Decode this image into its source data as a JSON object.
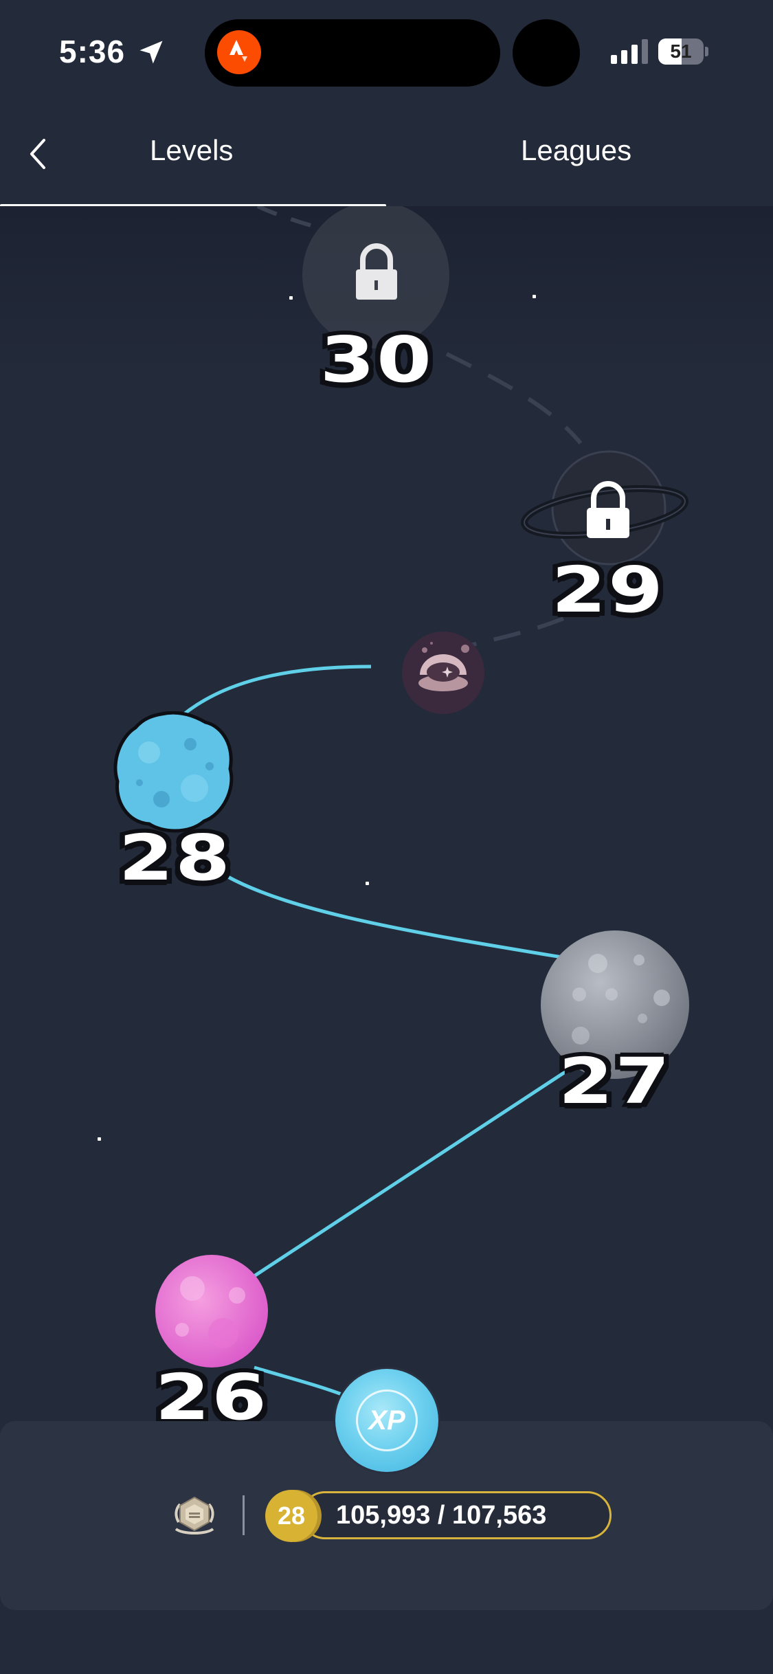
{
  "status_bar": {
    "time": "5:36",
    "battery": "51",
    "battery_level": 0.51,
    "icons": [
      "location-arrow-icon",
      "strava-icon",
      "signal-icon",
      "battery-icon"
    ]
  },
  "tabs": [
    {
      "label": "Levels",
      "selected": true
    },
    {
      "label": "Leagues",
      "selected": false
    }
  ],
  "levels": [
    {
      "number": "30",
      "state": "locked",
      "planet": "faded-locked"
    },
    {
      "number": "29",
      "state": "locked",
      "planet": "ringed-locked"
    },
    {
      "number": "28",
      "state": "current",
      "planet": "blue-rocky"
    },
    {
      "number": "27",
      "state": "completed",
      "planet": "gray-moon"
    },
    {
      "number": "26",
      "state": "completed",
      "planet": "pink-bubbly"
    }
  ],
  "progress": {
    "current_level": "28",
    "xp_text": "105,993 / 107,563",
    "xp_current": 105993,
    "xp_target": 107563,
    "xp_badge": "XP"
  },
  "colors": {
    "background": "#232a3a",
    "path": "#5fd0e8",
    "accent_gold": "#d9b43c",
    "strava": "#fc4c02"
  }
}
